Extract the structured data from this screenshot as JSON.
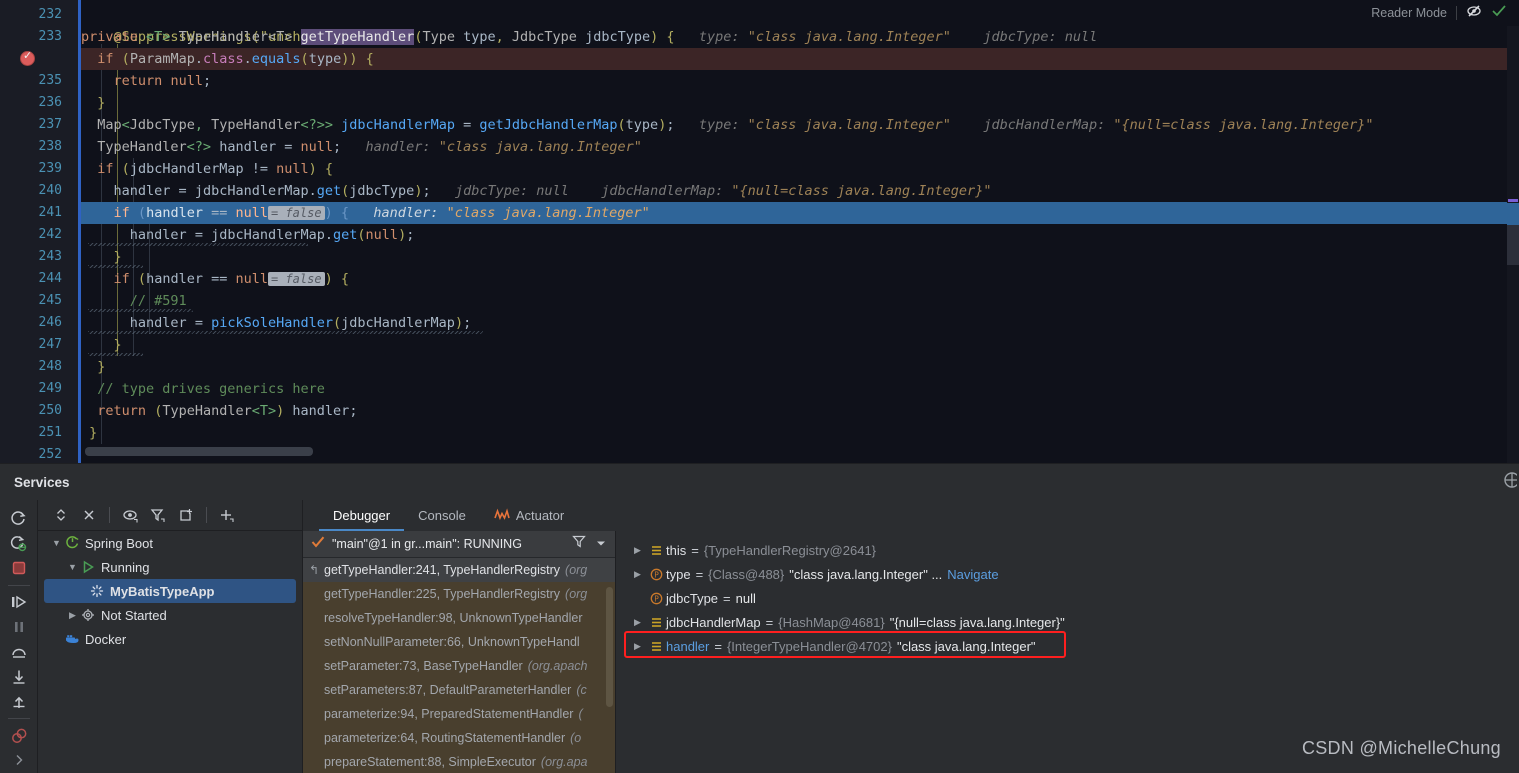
{
  "editor": {
    "reader_mode_label": "Reader Mode",
    "reader_mode_icon": "eye-crossed-icon",
    "inspection_icon": "checkmark-green-icon",
    "breakpoint_line": 234,
    "execution_line": 241,
    "lines": [
      {
        "n": "232",
        "indent": 2,
        "tokens": [
          {
            "t": "@SuppressWarnings",
            "c": "ann"
          },
          {
            "t": "(",
            "c": "br"
          },
          {
            "t": "\"unchecked\"",
            "c": "str"
          },
          {
            "t": ")",
            "c": "br"
          }
        ]
      },
      {
        "n": "233",
        "indent": 2,
        "tokens": []
      },
      {
        "n": "234",
        "indent": 4,
        "tokens": []
      },
      {
        "n": "235",
        "indent": 6,
        "tokens": []
      },
      {
        "n": "236",
        "indent": 4,
        "tokens": []
      },
      {
        "n": "237",
        "indent": 4,
        "tokens": []
      },
      {
        "n": "238",
        "indent": 4,
        "tokens": []
      },
      {
        "n": "239",
        "indent": 4,
        "tokens": []
      },
      {
        "n": "240",
        "indent": 6,
        "tokens": []
      },
      {
        "n": "241",
        "indent": 6,
        "tokens": []
      },
      {
        "n": "242",
        "indent": 8,
        "tokens": []
      },
      {
        "n": "243",
        "indent": 6,
        "tokens": []
      },
      {
        "n": "244",
        "indent": 6,
        "tokens": []
      },
      {
        "n": "245",
        "indent": 8,
        "tokens": []
      },
      {
        "n": "246",
        "indent": 8,
        "tokens": []
      },
      {
        "n": "247",
        "indent": 6,
        "tokens": []
      },
      {
        "n": "248",
        "indent": 4,
        "tokens": []
      },
      {
        "n": "249",
        "indent": 4,
        "tokens": []
      },
      {
        "n": "250",
        "indent": 4,
        "tokens": []
      },
      {
        "n": "251",
        "indent": 2,
        "tokens": []
      },
      {
        "n": "252",
        "indent": 0,
        "tokens": []
      }
    ],
    "line_numbers": [
      "232",
      "233",
      "235",
      "236",
      "237",
      "238",
      "239",
      "240",
      "241",
      "242",
      "243",
      "244",
      "245",
      "246",
      "247",
      "248",
      "249",
      "250",
      "251",
      "252"
    ],
    "code_text": {
      "l232": "@SuppressWarnings(\"unchecked\")",
      "l233": "private <T> TypeHandler<T> getTypeHandler(Type type, JdbcType jdbcType) {",
      "l233_hint_type": "type:",
      "l233_hint_type_val": "\"class java.lang.Integer\"",
      "l233_hint_jdbc": "jdbcType:",
      "l233_hint_jdbc_val": "null",
      "l234": "if (ParamMap.class.equals(type)) {",
      "l235": "return null;",
      "l236": "}",
      "l237": "Map<JdbcType, TypeHandler<?>> jdbcHandlerMap = getJdbcHandlerMap(type);",
      "l237_hint_type": "type:",
      "l237_hint_type_val": "\"class java.lang.Integer\"",
      "l237_hint_map": "jdbcHandlerMap:",
      "l237_hint_map_val": "\"{null=class java.lang.Integer}\"",
      "l238": "TypeHandler<?> handler = null;",
      "l238_hint": "handler:",
      "l238_hint_val": "\"class java.lang.Integer\"",
      "l239": "if (jdbcHandlerMap != null) {",
      "l240": "handler = jdbcHandlerMap.get(jdbcType);",
      "l240_hint_jdbc": "jdbcType:",
      "l240_hint_jdbc_val": "null",
      "l240_hint_map": "jdbcHandlerMap:",
      "l240_hint_map_val": "\"{null=class java.lang.Integer}\"",
      "l241": "if (handler == null",
      "l241_inlay": "= false",
      "l241_rest": ") {",
      "l241_hint": "handler:",
      "l241_hint_val": "\"class java.lang.Integer\"",
      "l242": "handler = jdbcHandlerMap.get(null);",
      "l243": "}",
      "l244": "if (handler == null",
      "l244_inlay": "= false",
      "l244_rest": ") {",
      "l245": "// #591",
      "l246": "handler = pickSoleHandler(jdbcHandlerMap);",
      "l247": "}",
      "l248": "}",
      "l249": "// type drives generics here",
      "l250": "return (TypeHandler<T>) handler;",
      "l251": "}"
    }
  },
  "services": {
    "title": "Services",
    "header_icon": "settings-circle-icon",
    "run_toolbar": [
      {
        "name": "rerun-icon",
        "glyph": "rerun"
      },
      {
        "name": "rerun-debug-icon",
        "glyph": "rerun-debug"
      },
      {
        "name": "stop-icon",
        "glyph": "stop"
      },
      {
        "name": "resume-program-icon",
        "glyph": "resume"
      },
      {
        "name": "pause-program-icon",
        "glyph": "pause"
      },
      {
        "name": "step-over-icon",
        "glyph": "step-over"
      },
      {
        "name": "step-into-icon",
        "glyph": "step-into"
      },
      {
        "name": "step-out-icon",
        "glyph": "step-out"
      },
      {
        "name": "mute-breakpoints-icon",
        "glyph": "mute-breakpoints"
      },
      {
        "name": "expand-toolbar-icon",
        "glyph": "chevron-right"
      }
    ],
    "tree_toolbar": [
      {
        "name": "expand-collapse-icon",
        "glyph": "updown"
      },
      {
        "name": "stop-service-icon",
        "glyph": "x"
      },
      {
        "name": "show-hide-icon",
        "glyph": "eye"
      },
      {
        "name": "filter-icon",
        "glyph": "funnel"
      },
      {
        "name": "open-in-new-window-icon",
        "glyph": "newwin"
      },
      {
        "name": "add-service-icon",
        "glyph": "plus"
      }
    ],
    "tree": [
      {
        "label": "Spring Boot",
        "level": 0,
        "arrow": "down",
        "icon": "spring-boot-icon",
        "selected": false
      },
      {
        "label": "Running",
        "level": 1,
        "arrow": "down",
        "icon": "run-green-icon",
        "selected": false
      },
      {
        "label": "MyBatisTypeApp",
        "level": 2,
        "arrow": "none",
        "icon": "spinner-icon",
        "selected": true
      },
      {
        "label": "Not Started",
        "level": 1,
        "arrow": "right",
        "icon": "gear-icon",
        "selected": false
      },
      {
        "label": "Docker",
        "level": 0,
        "arrow": "none",
        "icon": "docker-whale-icon",
        "selected": false
      }
    ]
  },
  "debugger": {
    "tabs": [
      {
        "label": "Debugger",
        "active": true,
        "icon": "none"
      },
      {
        "label": "Console",
        "active": false,
        "icon": "none"
      },
      {
        "label": "Actuator",
        "active": false,
        "icon": "actuator-icon"
      }
    ],
    "thread_selector": {
      "status_icon": "checkmark-orange-icon",
      "label": "\"main\"@1 in gr...main\": RUNNING",
      "filter_icon": "funnel-icon",
      "dropdown_icon": "chevron-down-icon"
    },
    "frames": [
      {
        "method": "getTypeHandler:241, TypeHandlerRegistry",
        "pkg": "(org",
        "current": true
      },
      {
        "method": "getTypeHandler:225, TypeHandlerRegistry",
        "pkg": "(org",
        "current": false
      },
      {
        "method": "resolveTypeHandler:98, UnknownTypeHandler",
        "pkg": "",
        "current": false
      },
      {
        "method": "setNonNullParameter:66, UnknownTypeHandl",
        "pkg": "",
        "current": false
      },
      {
        "method": "setParameter:73, BaseTypeHandler",
        "pkg": "(org.apach",
        "current": false
      },
      {
        "method": "setParameters:87, DefaultParameterHandler",
        "pkg": "(c",
        "current": false
      },
      {
        "method": "parameterize:94, PreparedStatementHandler",
        "pkg": "(",
        "current": false
      },
      {
        "method": "parameterize:64, RoutingStatementHandler",
        "pkg": "(o",
        "current": false
      },
      {
        "method": "prepareStatement:88, SimpleExecutor",
        "pkg": "(org.apa",
        "current": false
      }
    ],
    "variables": [
      {
        "arrow": "right",
        "icon": "field-list-icon",
        "name": "this",
        "eq": "=",
        "ref": "{TypeHandlerRegistry@2641}",
        "value": "",
        "navigate": "",
        "highlighted": false,
        "link": false
      },
      {
        "arrow": "right",
        "icon": "parameter-icon",
        "name": "type",
        "eq": "=",
        "ref": "{Class@488}",
        "value": "\"class java.lang.Integer\" ...",
        "navigate": "Navigate",
        "highlighted": false,
        "link": false
      },
      {
        "arrow": "none",
        "icon": "parameter-icon",
        "name": "jdbcType",
        "eq": "=",
        "ref": "",
        "value": "null",
        "navigate": "",
        "highlighted": false,
        "link": false
      },
      {
        "arrow": "right",
        "icon": "field-list-icon",
        "name": "jdbcHandlerMap",
        "eq": "=",
        "ref": "{HashMap@4681}",
        "value": "\"{null=class java.lang.Integer}\"",
        "navigate": "",
        "highlighted": false,
        "link": false
      },
      {
        "arrow": "right",
        "icon": "field-list-icon",
        "name": "handler",
        "eq": "=",
        "ref": "{IntegerTypeHandler@4702}",
        "value": "\"class java.lang.Integer\"",
        "navigate": "",
        "highlighted": true,
        "link": true
      }
    ]
  },
  "watermark": "CSDN @MichelleChung",
  "colors": {
    "accent_blue": "#2f6599",
    "highlight_red": "#ff1f1f",
    "selection_blue": "#2f5484",
    "frames_bg": "#493f2e"
  }
}
